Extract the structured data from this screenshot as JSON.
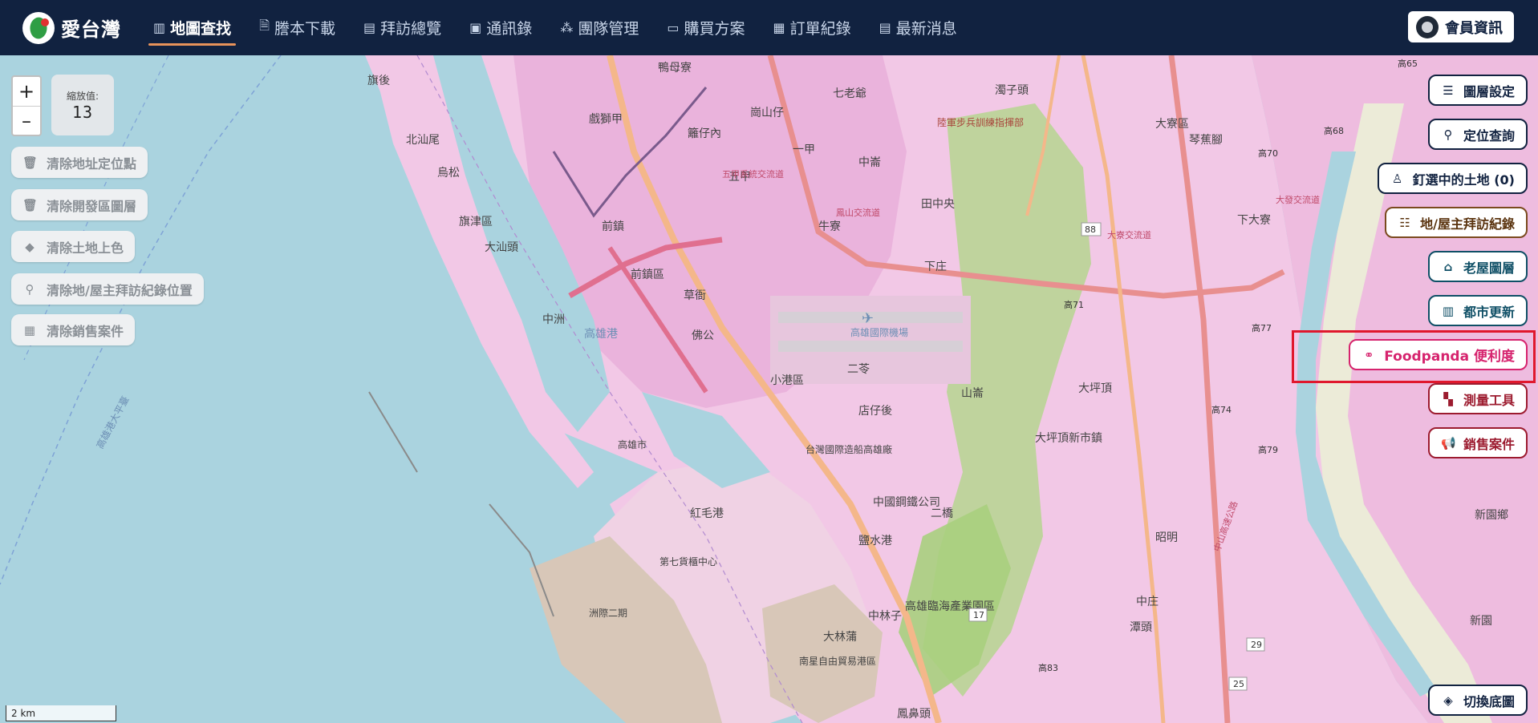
{
  "app": {
    "name": "愛台灣"
  },
  "nav": [
    {
      "label": "地圖查找",
      "icon": "map-icon",
      "glyph": "▥",
      "active": true
    },
    {
      "label": "謄本下載",
      "icon": "document-icon",
      "glyph": "🗎",
      "active": false
    },
    {
      "label": "拜訪總覽",
      "icon": "report-icon",
      "glyph": "▤",
      "active": false
    },
    {
      "label": "通訊錄",
      "icon": "contact-card-icon",
      "glyph": "▣",
      "active": false
    },
    {
      "label": "團隊管理",
      "icon": "team-hierarchy-icon",
      "glyph": "⁂",
      "active": false
    },
    {
      "label": "購買方案",
      "icon": "folder-icon",
      "glyph": "▭",
      "active": false
    },
    {
      "label": "訂單紀錄",
      "icon": "receipt-icon",
      "glyph": "▦",
      "active": false
    },
    {
      "label": "最新消息",
      "icon": "newspaper-icon",
      "glyph": "▤",
      "active": false
    }
  ],
  "member": {
    "label": "會員資訊"
  },
  "zoom": {
    "plus": "+",
    "minus": "–",
    "label": "縮放值:",
    "value": "13"
  },
  "left_actions": [
    {
      "label": "清除地址定位點",
      "icon": "trash-icon",
      "glyph": "🗑"
    },
    {
      "label": "清除開發區圖層",
      "icon": "trash-icon",
      "glyph": "🗑"
    },
    {
      "label": "清除土地上色",
      "icon": "eraser-icon",
      "glyph": "◆"
    },
    {
      "label": "清除地/屋主拜訪紀錄位置",
      "icon": "user-location-icon",
      "glyph": "⚲"
    },
    {
      "label": "清除銷售案件",
      "icon": "building-icon",
      "glyph": "▦"
    }
  ],
  "right_actions": [
    {
      "label": "圖層設定",
      "icon": "sliders-icon",
      "glyph": "☰",
      "theme": "navy"
    },
    {
      "label": "定位查詢",
      "icon": "location-pin-icon",
      "glyph": "⚲",
      "theme": "navy"
    },
    {
      "label": "釘選中的土地 (0)",
      "icon": "user-pin-icon",
      "glyph": "♙",
      "theme": "navy"
    },
    {
      "label": "地/屋主拜訪紀錄",
      "icon": "user-list-icon",
      "glyph": "☷",
      "theme": "brown"
    },
    {
      "label": "老屋圖層",
      "icon": "house-icon",
      "glyph": "⌂",
      "theme": "teal"
    },
    {
      "label": "都市更新",
      "icon": "building-icon",
      "glyph": "▥",
      "theme": "teal"
    },
    {
      "label": "Foodpanda 便利度",
      "icon": "bicycle-icon",
      "glyph": "⚭",
      "theme": "pink"
    },
    {
      "label": "測量工具",
      "icon": "ruler-icon",
      "glyph": "▚",
      "theme": "maroon"
    },
    {
      "label": "銷售案件",
      "icon": "megaphone-icon",
      "glyph": "📢",
      "theme": "maroon"
    },
    {
      "label": "切換底圖",
      "icon": "layers-icon",
      "glyph": "◈",
      "theme": "navy"
    }
  ],
  "map": {
    "scale_label": "2 km",
    "place_labels": [
      "旗後",
      "北汕尾",
      "烏松",
      "旗津區",
      "大汕頭",
      "中洲",
      "高雄港",
      "戲獅甲",
      "前鎮",
      "前鎮區",
      "草衙",
      "佛公",
      "鴨母寮",
      "籬仔內",
      "崗山仔",
      "五甲",
      "一甲",
      "七老爺",
      "中崙",
      "田中央",
      "牛寮",
      "下庄",
      "小港區",
      "二苓",
      "店仔後",
      "山崙",
      "大坪頂",
      "大坪頂新市鎮",
      "紅毛港",
      "第七貨櫃中心",
      "洲際二期",
      "高雄市",
      "台灣國際造船高雄廠",
      "中國鋼鐵公司",
      "鹽水港",
      "二橋",
      "中林子",
      "高雄臨海產業園區",
      "大林蒲",
      "南星自由貿易港區",
      "鳳鼻頭",
      "大寮區",
      "琴蕉腳",
      "下大寮",
      "昭明",
      "中庄",
      "潭頭",
      "新園鄉",
      "新園",
      "陸軍步兵訓練指揮部",
      "濁子頭",
      "高雄國際機場",
      "高雄港大平臺",
      "五甲系統交流道",
      "鳳山交流道",
      "大發交流道",
      "大寮交流道",
      "中山高速公路"
    ],
    "route_badges": [
      "88",
      "17",
      "25",
      "29",
      "高65",
      "高68",
      "高70",
      "高71",
      "高74",
      "高77",
      "高79",
      "高83"
    ],
    "colors": {
      "water": "#aad3df",
      "land": "#f2c8e6",
      "urban": "#eab3dc",
      "green": "#b6d58f",
      "port": "#d8c7b8",
      "beach": "#ecebd8",
      "highway": "#e88f8f",
      "road": "#f4b78a"
    }
  }
}
